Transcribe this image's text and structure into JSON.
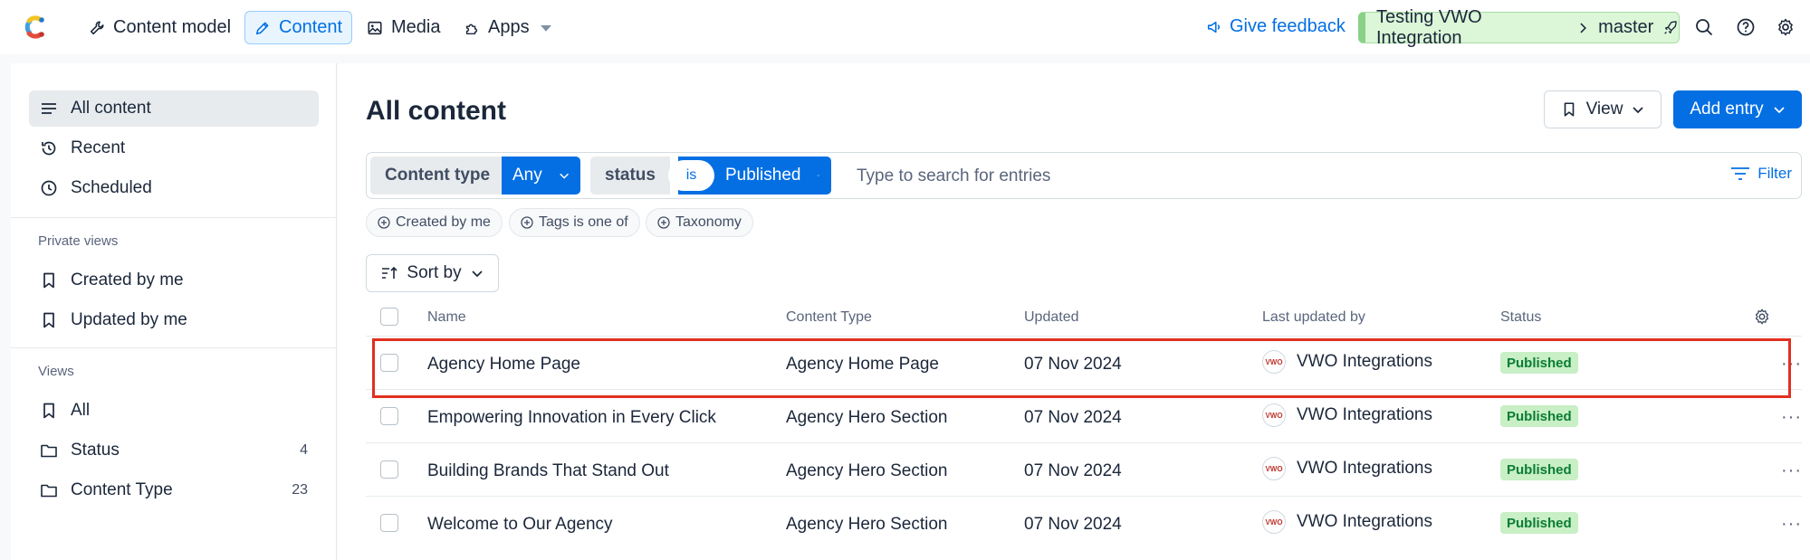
{
  "topbar": {
    "nav": [
      {
        "label": "Content model",
        "icon": "wrench-icon"
      },
      {
        "label": "Content",
        "icon": "pen-icon"
      },
      {
        "label": "Media",
        "icon": "image-icon"
      },
      {
        "label": "Apps",
        "icon": "puzzle-icon"
      }
    ],
    "feedback": "Give feedback",
    "space": "Testing VWO Integration",
    "environment": "master"
  },
  "sidebar": {
    "items": [
      {
        "label": "All content",
        "icon": "list-icon"
      },
      {
        "label": "Recent",
        "icon": "history-icon"
      },
      {
        "label": "Scheduled",
        "icon": "clock-icon"
      }
    ],
    "private_heading": "Private views",
    "private_items": [
      {
        "label": "Created by me",
        "icon": "bookmark-icon"
      },
      {
        "label": "Updated by me",
        "icon": "bookmark-icon"
      }
    ],
    "views_heading": "Views",
    "views": [
      {
        "label": "All",
        "icon": "bookmark-icon",
        "count": ""
      },
      {
        "label": "Status",
        "icon": "folder-icon",
        "count": "4"
      },
      {
        "label": "Content Type",
        "icon": "folder-icon",
        "count": "23"
      }
    ]
  },
  "main": {
    "title": "All content",
    "view_label": "View",
    "add_label": "Add entry",
    "filters": {
      "content_type_label": "Content type",
      "content_type_value": "Any",
      "status_label": "status",
      "status_operator": "is",
      "status_value": "Published",
      "search_placeholder": "Type to search for entries",
      "filter_label": "Filter"
    },
    "chips": [
      "Created by me",
      "Tags is one of",
      "Taxonomy"
    ],
    "sort_label": "Sort by",
    "table": {
      "columns": [
        "Name",
        "Content Type",
        "Updated",
        "Last updated by",
        "Status"
      ],
      "rows": [
        {
          "name": "Agency Home Page",
          "type": "Agency Home Page",
          "updated": "07 Nov 2024",
          "user": "VWO Integrations",
          "status": "Published"
        },
        {
          "name": "Empowering Innovation in Every Click",
          "type": "Agency Hero Section",
          "updated": "07 Nov 2024",
          "user": "VWO Integrations",
          "status": "Published"
        },
        {
          "name": "Building Brands That Stand Out",
          "type": "Agency Hero Section",
          "updated": "07 Nov 2024",
          "user": "VWO Integrations",
          "status": "Published"
        },
        {
          "name": "Welcome to Our Agency",
          "type": "Agency Hero Section",
          "updated": "07 Nov 2024",
          "user": "VWO Integrations",
          "status": "Published"
        }
      ],
      "avatar_text": "VWO"
    }
  },
  "colors": {
    "accent": "#036fe3",
    "published_bg": "#c8efc5",
    "published_text": "#0a7c35",
    "highlight": "#e1301f"
  }
}
